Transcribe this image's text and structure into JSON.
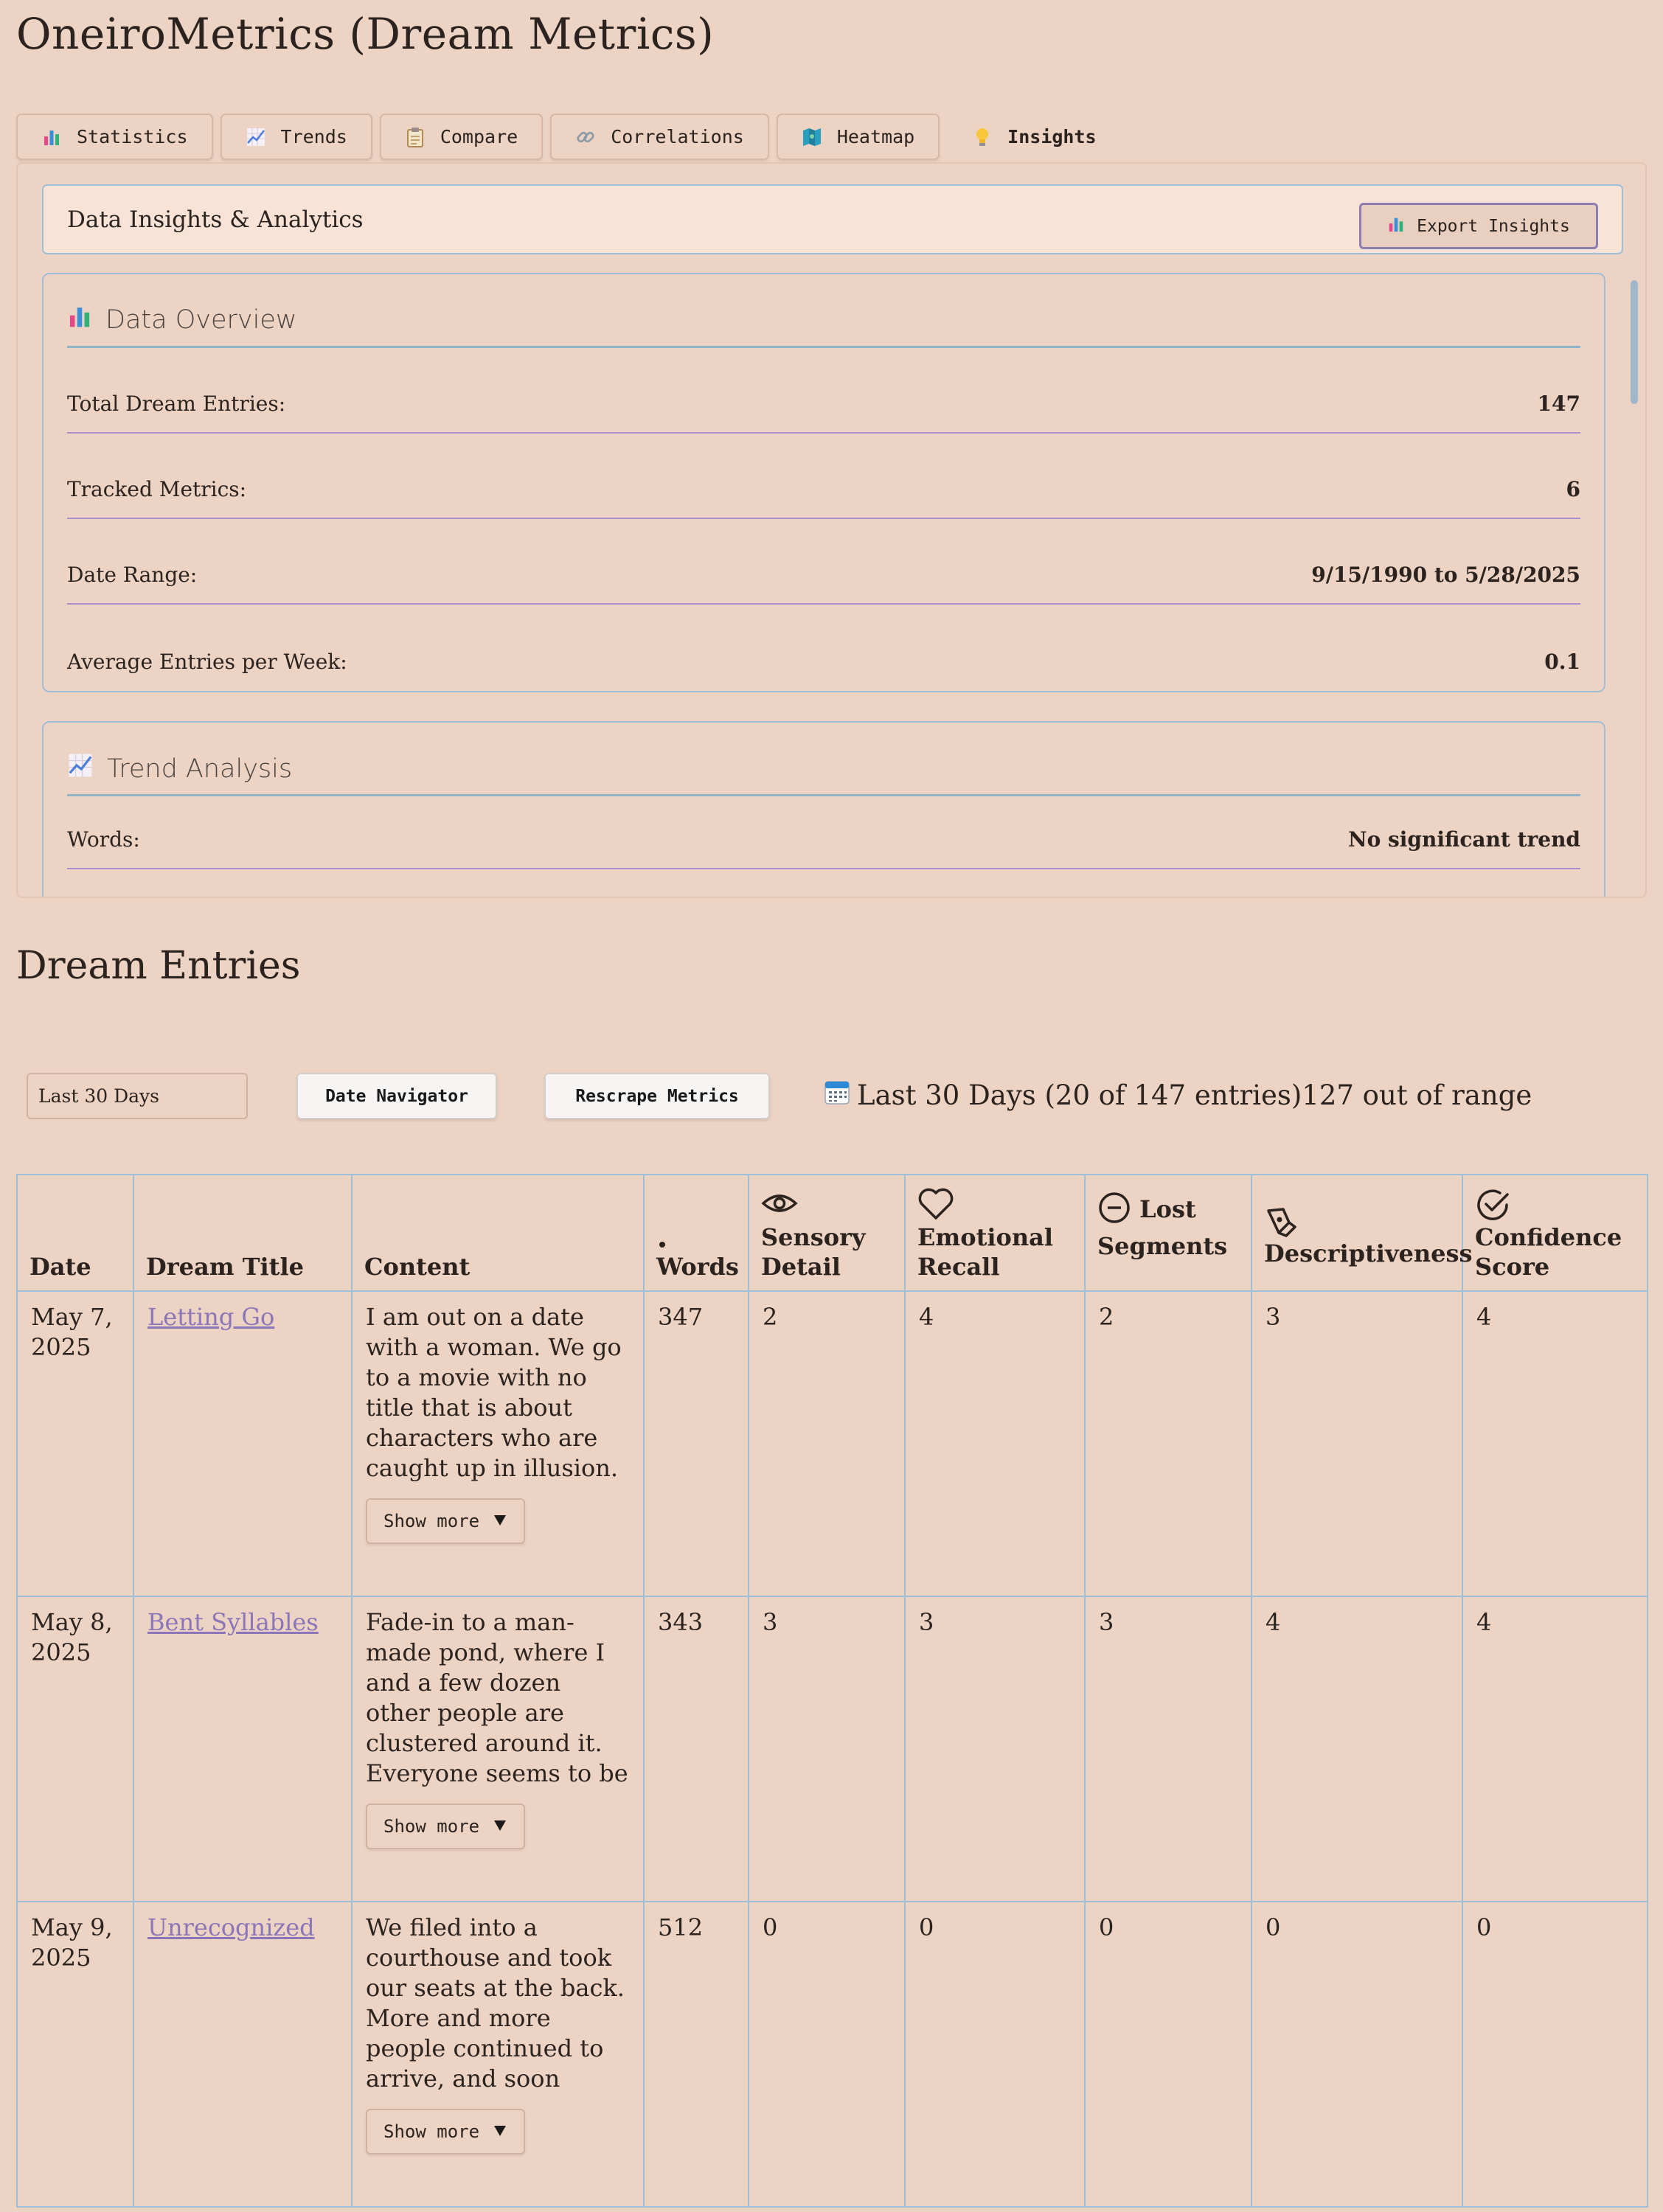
{
  "app": {
    "title": "OneiroMetrics (Dream Metrics)"
  },
  "tabs": [
    {
      "label": "Statistics",
      "icon": "bar-chart-icon"
    },
    {
      "label": "Trends",
      "icon": "trend-chart-icon"
    },
    {
      "label": "Compare",
      "icon": "clipboard-icon"
    },
    {
      "label": "Correlations",
      "icon": "link-icon"
    },
    {
      "label": "Heatmap",
      "icon": "map-icon"
    },
    {
      "label": "Insights",
      "icon": "lightbulb-icon",
      "active": true
    }
  ],
  "insights": {
    "header_title": "Data Insights & Analytics",
    "export_label": "Export Insights",
    "overview": {
      "title": "Data Overview",
      "rows": [
        {
          "label": "Total Dream Entries:",
          "value": "147"
        },
        {
          "label": "Tracked Metrics:",
          "value": "6"
        },
        {
          "label": "Date Range:",
          "value": "9/15/1990 to 5/28/2025"
        },
        {
          "label": "Average Entries per Week:",
          "value": "0.1"
        }
      ]
    },
    "trend": {
      "title": "Trend Analysis",
      "rows": [
        {
          "label": "Words:",
          "value": "No significant trend"
        }
      ]
    }
  },
  "entries": {
    "title": "Dream Entries",
    "range_select": "Last 30 Days",
    "date_navigator_label": "Date Navigator",
    "rescrape_label": "Rescrape Metrics",
    "status_text": "Last 30 Days (20 of 147 entries)127 out of range",
    "columns": {
      "date": "Date",
      "title": "Dream Title",
      "content": "Content",
      "words": "Words",
      "sensory": "Sensory Detail",
      "emotional": "Emotional Recall",
      "lost": "Lost Segments",
      "descriptiveness": "Descriptiveness",
      "confidence": "Confidence Score"
    },
    "show_more_label": "Show more",
    "rows": [
      {
        "date": "May 7, 2025",
        "title": "Letting Go",
        "content": "I am out on a date with a woman. We go to a movie with no title that is about characters who are caught up in illusion. Two women (in the",
        "words": "347",
        "sensory": "2",
        "emotional": "4",
        "lost": "2",
        "descriptiveness": "3",
        "confidence": "4"
      },
      {
        "date": "May 8, 2025",
        "title": "Bent Syllables",
        "content": "Fade-in to a man-made pond, where I and a few dozen other people are clustered around it. Everyone seems to be in happy. I call out to my",
        "words": "343",
        "sensory": "3",
        "emotional": "3",
        "lost": "3",
        "descriptiveness": "4",
        "confidence": "4"
      },
      {
        "date": "May 9, 2025",
        "title": "Unrecognized",
        "content": "We filed into a courthouse and took our seats at the back. More and more people continued to arrive, and soon every seat was full.",
        "words": "512",
        "sensory": "0",
        "emotional": "0",
        "lost": "0",
        "descriptiveness": "0",
        "confidence": "0"
      }
    ]
  }
}
